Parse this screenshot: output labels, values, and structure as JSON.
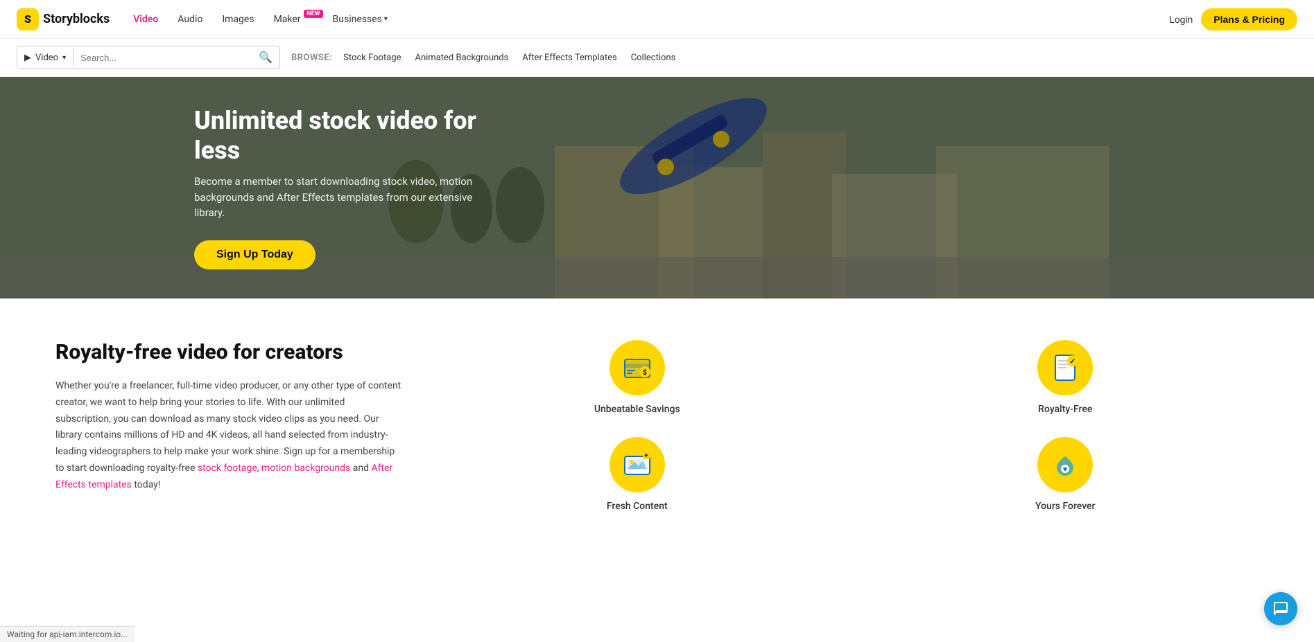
{
  "navbar": {
    "logo_text": "Storyblocks",
    "logo_icon": "S",
    "nav_links": [
      {
        "id": "video",
        "label": "Video",
        "active": true,
        "badge": null
      },
      {
        "id": "audio",
        "label": "Audio",
        "active": false,
        "badge": null
      },
      {
        "id": "images",
        "label": "Images",
        "active": false,
        "badge": null
      },
      {
        "id": "maker",
        "label": "Maker",
        "active": false,
        "badge": "NEW"
      },
      {
        "id": "businesses",
        "label": "Businesses",
        "active": false,
        "badge": null,
        "dropdown": true
      }
    ],
    "login_label": "Login",
    "plans_btn_label": "Plans & Pricing"
  },
  "search": {
    "category_label": "Video",
    "placeholder": "Search...",
    "browse_label": "BROWSE:",
    "browse_links": [
      {
        "id": "stock-footage",
        "label": "Stock Footage"
      },
      {
        "id": "animated-backgrounds",
        "label": "Animated Backgrounds"
      },
      {
        "id": "after-effects-templates",
        "label": "After Effects Templates"
      },
      {
        "id": "collections",
        "label": "Collections"
      }
    ]
  },
  "hero": {
    "title": "Unlimited stock video for less",
    "subtitle": "Become a member to start downloading stock video, motion backgrounds and After Effects templates from our extensive library.",
    "cta_label": "Sign Up Today"
  },
  "content": {
    "title": "Royalty-free video for creators",
    "body": "Whether you're a freelancer, full-time video producer, or any other type of content creator, we want to help bring your stories to life. With our unlimited subscription, you can download as many stock video clips as you need. Our library contains millions of HD and 4K videos, all hand selected from industry-leading videographers to help make your work shine. Sign up for a membership to start downloading royalty-free",
    "link1_text": "stock footage",
    "link2_text": "motion backgrounds",
    "link3_text": "After Effects templates",
    "tail_text": "today!",
    "separator_text": "and",
    "comma_text": ","
  },
  "features": [
    {
      "id": "unbeatable-savings",
      "label": "Unbeatable Savings",
      "icon": "💰",
      "icon_color": "#FFD600"
    },
    {
      "id": "royalty-free",
      "label": "Royalty-Free",
      "icon": "📋",
      "icon_color": "#FFD600"
    },
    {
      "id": "fresh-content",
      "label": "Fresh Content",
      "icon": "🖼️",
      "icon_color": "#FFD600"
    },
    {
      "id": "yours-forever",
      "label": "Yours Forever",
      "icon": "📌",
      "icon_color": "#FFD600"
    }
  ],
  "status": {
    "text": "Waiting for api-iam.intercom.io..."
  },
  "chat": {
    "aria_label": "Open chat"
  }
}
